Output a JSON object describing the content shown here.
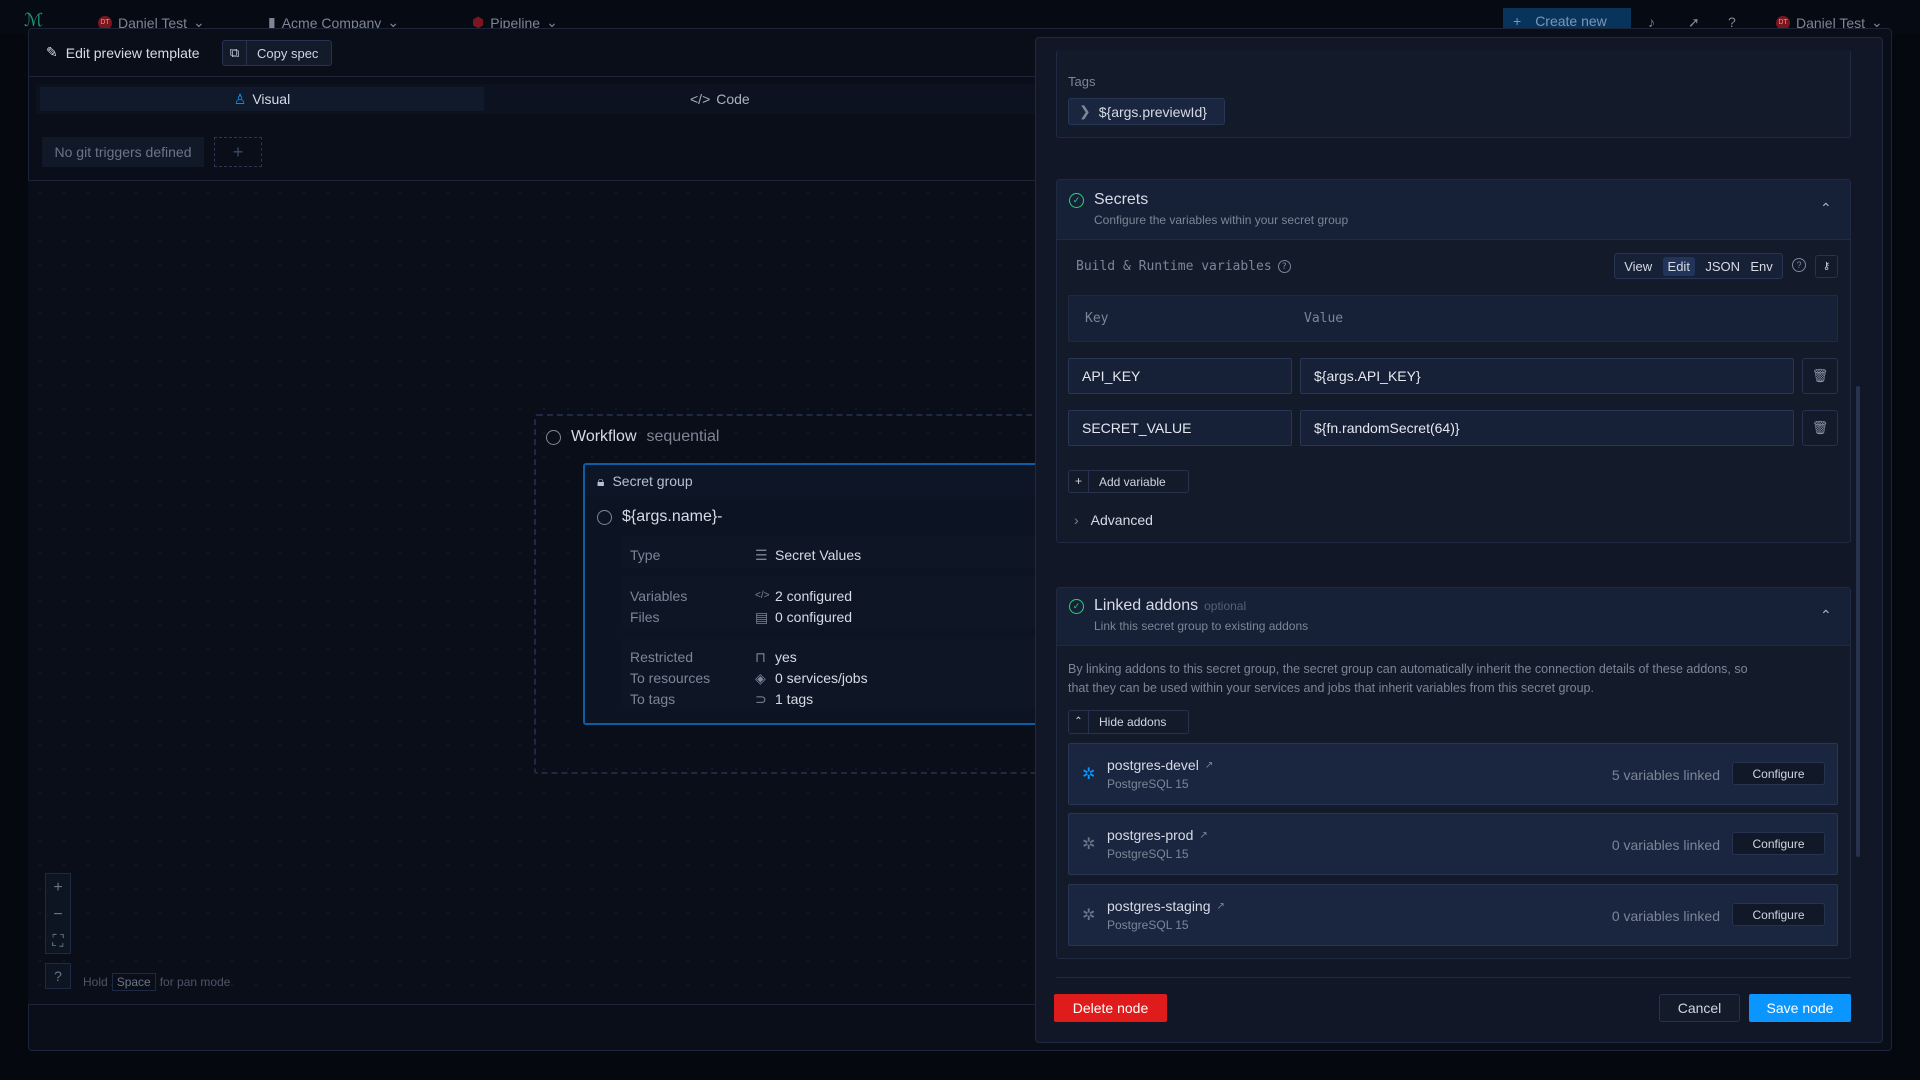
{
  "topbar": {
    "user": "Daniel Test",
    "user_initials": "DT",
    "company": "Acme Company",
    "pipeline": "Pipeline",
    "create_new": "Create new",
    "account": "Daniel Test"
  },
  "modal": {
    "title": "Edit preview template",
    "copy_spec": "Copy spec",
    "tabs": [
      {
        "label": "Visual",
        "active": true
      },
      {
        "label": "Code",
        "active": false
      }
    ],
    "git_triggers": "No git triggers defined"
  },
  "canvas": {
    "workflow_title": "Workflow",
    "workflow_mode": "sequential",
    "node": {
      "kind": "Secret group",
      "name": "${args.name}-",
      "rows": [
        {
          "label": "Type",
          "value": "Secret Values"
        },
        {
          "label": "Variables",
          "value": "2 configured"
        },
        {
          "label": "Files",
          "value": "0 configured"
        },
        {
          "label": "Restricted",
          "value": "yes"
        },
        {
          "label": "To resources",
          "value": "0 services/jobs"
        },
        {
          "label": "To tags",
          "value": "1 tags"
        }
      ]
    },
    "hint_hold": "Hold",
    "hint_key": "Space",
    "hint_rest": "for pan mode"
  },
  "panel": {
    "tags_label": "Tags",
    "tag": "${args.previewId}",
    "secrets": {
      "title": "Secrets",
      "subtitle": "Configure the variables within your secret group",
      "vars_label": "Build & Runtime variables",
      "modes": [
        "View",
        "Edit",
        "JSON",
        "Env"
      ],
      "active_mode": "Edit",
      "col_key": "Key",
      "col_value": "Value",
      "rows": [
        {
          "key": "API_KEY",
          "value": "${args.API_KEY}"
        },
        {
          "key": "SECRET_VALUE",
          "value": "${fn.randomSecret(64)}"
        }
      ],
      "add_variable": "Add variable",
      "advanced": "Advanced"
    },
    "addons": {
      "title": "Linked addons",
      "optional": "optional",
      "subtitle": "Link this secret group to existing addons",
      "description_1": "By linking addons to this secret group, the secret group can automatically inherit the connection details of these addons, so",
      "description_2": "that they can be used within your services and jobs that inherit variables from this secret group.",
      "hide_addons": "Hide addons",
      "configure": "Configure",
      "items": [
        {
          "name": "postgres-devel",
          "type": "PostgreSQL 15",
          "linked": "5 variables linked",
          "active": true
        },
        {
          "name": "postgres-prod",
          "type": "PostgreSQL 15",
          "linked": "0 variables linked",
          "active": false
        },
        {
          "name": "postgres-staging",
          "type": "PostgreSQL 15",
          "linked": "0 variables linked",
          "active": false
        }
      ]
    },
    "delete_node": "Delete node",
    "cancel": "Cancel",
    "save_node": "Save node"
  },
  "colors": {
    "accent": "#0a95ff",
    "danger": "#e01b1b",
    "success": "#2ecf7a"
  }
}
